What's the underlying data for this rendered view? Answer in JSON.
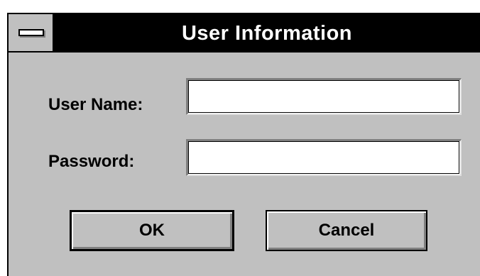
{
  "window": {
    "title": "User Information"
  },
  "form": {
    "username_label": "User Name:",
    "username_value": "",
    "password_label": "Password:",
    "password_value": ""
  },
  "buttons": {
    "ok_label": "OK",
    "cancel_label": "Cancel"
  },
  "colors": {
    "dialog_face": "#c0c0c0",
    "titlebar": "#000000",
    "title_text": "#ffffff",
    "field_background": "#ffffff"
  },
  "icons": {
    "system_menu": "system-menu-icon"
  }
}
